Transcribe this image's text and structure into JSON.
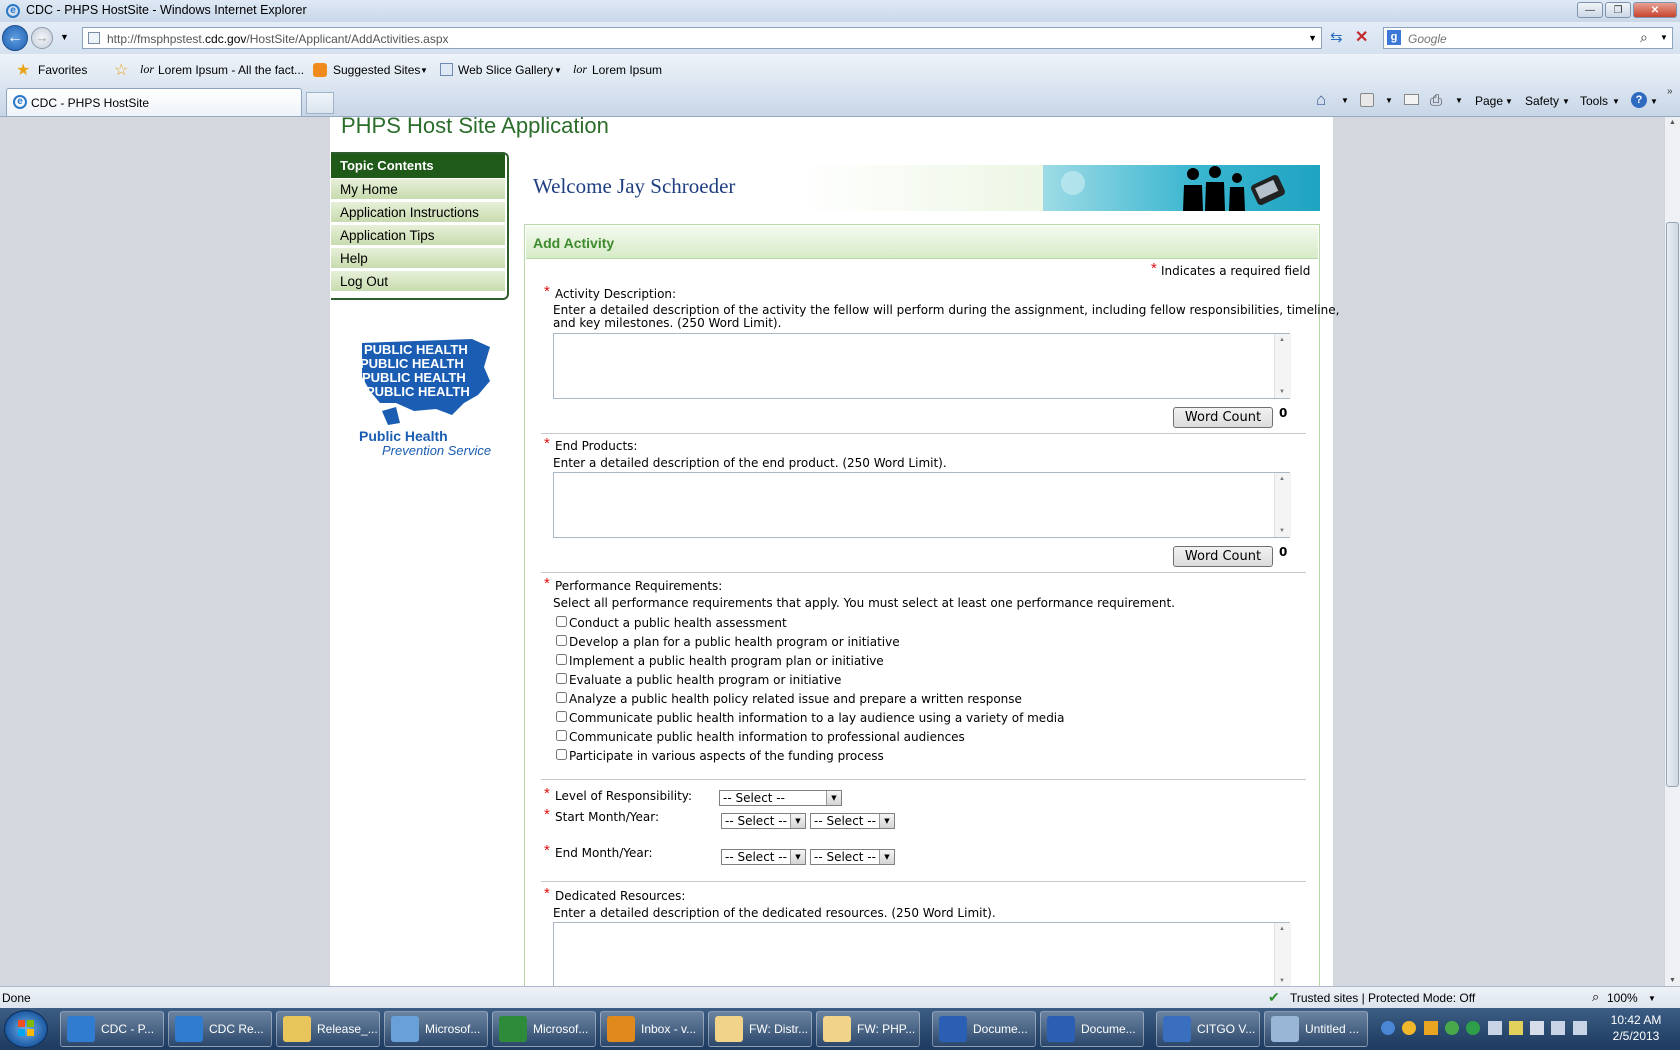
{
  "window": {
    "title": "CDC - PHPS HostSite - Windows Internet Explorer"
  },
  "address_bar": {
    "url_prefix": "http://fmsphpstest.",
    "url_domain": "cdc.gov",
    "url_path": "/HostSite/Applicant/AddActivities.aspx"
  },
  "search": {
    "placeholder": "Google"
  },
  "favorites_bar": {
    "favorites": "Favorites",
    "items": [
      "Lorem Ipsum - All the fact...",
      "Suggested Sites",
      "Web Slice Gallery",
      "Lorem Ipsum"
    ]
  },
  "tab": {
    "label": "CDC - PHPS HostSite"
  },
  "command_bar": {
    "page": "Page",
    "safety": "Safety",
    "tools": "Tools"
  },
  "app": {
    "title": "PHPS Host Site Application",
    "welcome": "Welcome Jay Schroeder"
  },
  "sidebar": {
    "heading": "Topic Contents",
    "items": [
      "My Home",
      "Application Instructions",
      "Application Tips",
      "Help",
      "Log Out"
    ]
  },
  "logo": {
    "line1": "Public Health",
    "line2": "Prevention Service",
    "pattern": "PUBLIC HEALTH"
  },
  "form": {
    "heading": "Add Activity",
    "required_note": "Indicates a required field",
    "activity_description": {
      "label": "Activity Description:",
      "help1": "Enter a detailed description of the activity the fellow will perform during the assignment, including fellow responsibilities, timeline,",
      "help2": "and key milestones. (250 Word Limit).",
      "word_count": "0"
    },
    "end_products": {
      "label": "End Products:",
      "help": "Enter a detailed description of the end product. (250 Word Limit).",
      "word_count": "0"
    },
    "word_count_button": "Word Count",
    "performance": {
      "label": "Performance Requirements:",
      "help": "Select all performance requirements that apply. You must select at least one performance requirement.",
      "options": [
        "Conduct a public health assessment",
        "Develop a plan for a public health program or initiative",
        "Implement a public health program plan or initiative",
        "Evaluate a public health program or initiative",
        "Analyze a public health policy related issue and prepare a written response",
        "Communicate public health information to a lay audience using a variety of media",
        "Communicate public health information to professional audiences",
        "Participate in various aspects of the funding process"
      ]
    },
    "level_label": "Level of Responsibility:",
    "start_label": "Start Month/Year:",
    "end_label": "End Month/Year:",
    "select_value": "-- Select --",
    "select_short": "-- Select --",
    "dedicated": {
      "label": "Dedicated Resources:",
      "help": "Enter a detailed description of the dedicated resources. (250 Word Limit)."
    }
  },
  "status_bar": {
    "left": "Done",
    "zone": "Trusted sites | Protected Mode: Off",
    "zoom": "100%"
  },
  "taskbar": {
    "items": [
      "CDC - P...",
      "CDC Re...",
      "Release_...",
      "Microsof...",
      "Microsof...",
      "Inbox - v...",
      "FW: Distr...",
      "FW: PHP...",
      "Docume...",
      "Docume...",
      "CITGO V...",
      "Untitled ..."
    ],
    "time": "10:42 AM",
    "date": "2/5/2013"
  },
  "colors": {
    "accent_green": "#1f5a18",
    "title_blue": "#1f3f82",
    "required_red": "#dd1111"
  }
}
